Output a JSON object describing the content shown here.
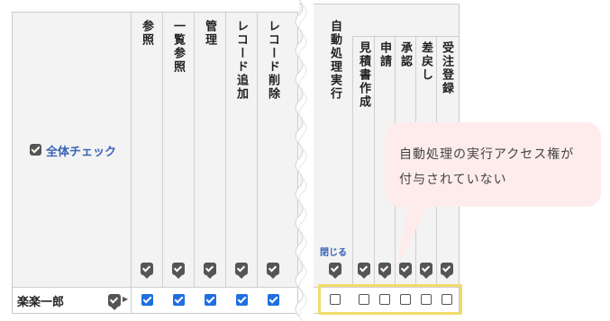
{
  "check_all": {
    "label": "全体チェック"
  },
  "left_columns": [
    {
      "label": "参照"
    },
    {
      "label": "一覧参照"
    },
    {
      "label": "管理"
    },
    {
      "label": "レコード追加"
    },
    {
      "label": "レコード削除"
    }
  ],
  "group": {
    "label": "自動処理実行",
    "close_label": "閉じる"
  },
  "right_columns": [
    {
      "label": "見積書作成"
    },
    {
      "label": "申請"
    },
    {
      "label": "承認"
    },
    {
      "label": "差戻し"
    },
    {
      "label": "受注登録"
    }
  ],
  "rows": [
    {
      "name": "楽楽一郎"
    }
  ],
  "callout": {
    "line1": "自動処理の実行アクセス権が",
    "line2": "付与されていない"
  }
}
